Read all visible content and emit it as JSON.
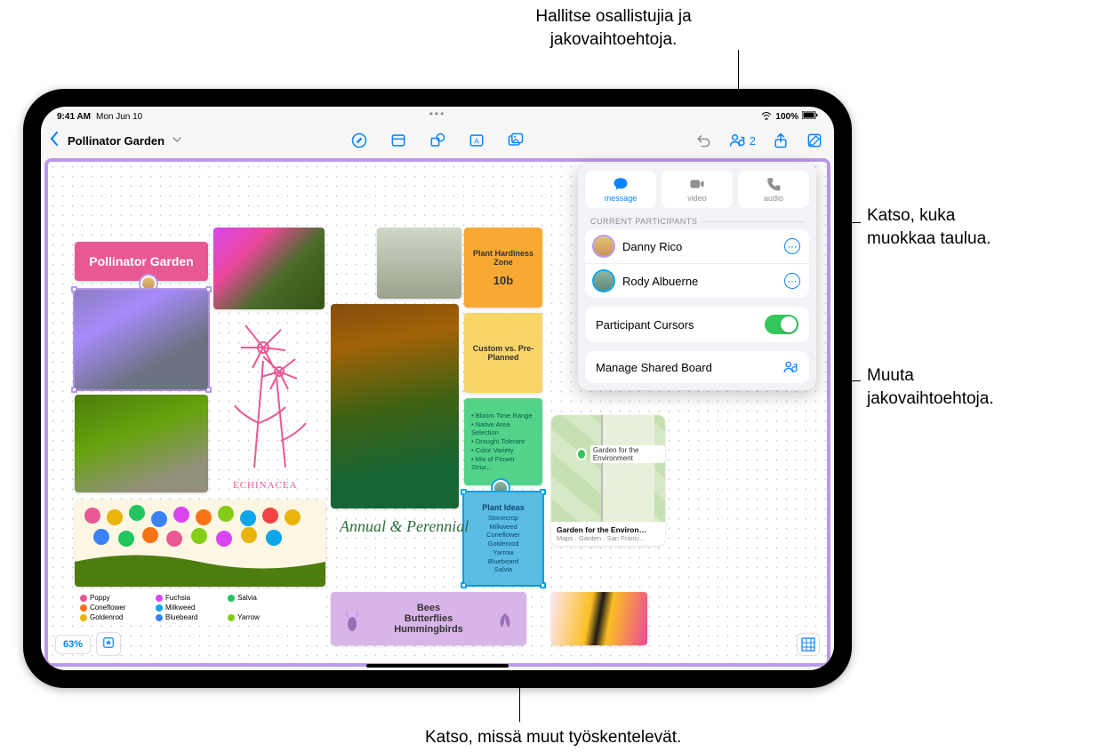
{
  "callouts": {
    "top": "Hallitse osallistujia ja\njakovaihtoehtoja.",
    "right1": "Katso, kuka\nmuokkaa taulua.",
    "right2": "Muuta\njakovaihtoehtoja.",
    "bottom": "Katso, missä muut työskentelevät."
  },
  "status": {
    "time": "9:41 AM",
    "date": "Mon Jun 10",
    "battery": "100%"
  },
  "document_title": "Pollinator Garden",
  "toolbar": {
    "collab_count": "2"
  },
  "popover": {
    "message": "message",
    "video": "video",
    "audio": "audio",
    "section": "CURRENT PARTICIPANTS",
    "p1": "Danny Rico",
    "p2": "Rody Albuerne",
    "cursors": "Participant Cursors",
    "manage": "Manage Shared Board"
  },
  "canvas": {
    "title_sticky": "Pollinator Garden",
    "hardiness": "Plant Hardiness Zone",
    "hardiness_val": "10b",
    "custom": "Custom vs. Pre-Planned",
    "bloom_list": [
      "Bloom Time Range",
      "Native Area Selection",
      "Drought Tolerant",
      "Color Variety",
      "Mix of Flower Struc..."
    ],
    "ideas_title": "Plant Ideas",
    "ideas_list": [
      "Stonecrop",
      "Milkweed",
      "Coneflower",
      "Goldenrod",
      "Yarrow",
      "Bluebeard",
      "Salvia"
    ],
    "bees": "Bees\nButterflies\nHummingbirds",
    "annual": "Annual & Perennial",
    "echinacea": "ECHINACEA",
    "map_title": "Garden for the Environ…",
    "map_sub": "Maps · Garden · San Franci…",
    "map_pin": "Garden for the Environment",
    "zoom": "63%",
    "legend": [
      {
        "c": "#e85994",
        "n": "Poppy"
      },
      {
        "c": "#d946ef",
        "n": "Fuchsia"
      },
      {
        "c": "#22c55e",
        "n": "Salvia"
      },
      {
        "c": "#f97316",
        "n": "Coneflower"
      },
      {
        "c": "#0ea5e9",
        "n": "Milkweed"
      },
      {
        "c": "#eab308",
        "n": "Goldenrod"
      },
      {
        "c": "#3b82f6",
        "n": "Bluebeard"
      },
      {
        "c": "#84cc16",
        "n": "Yarrow"
      }
    ]
  }
}
